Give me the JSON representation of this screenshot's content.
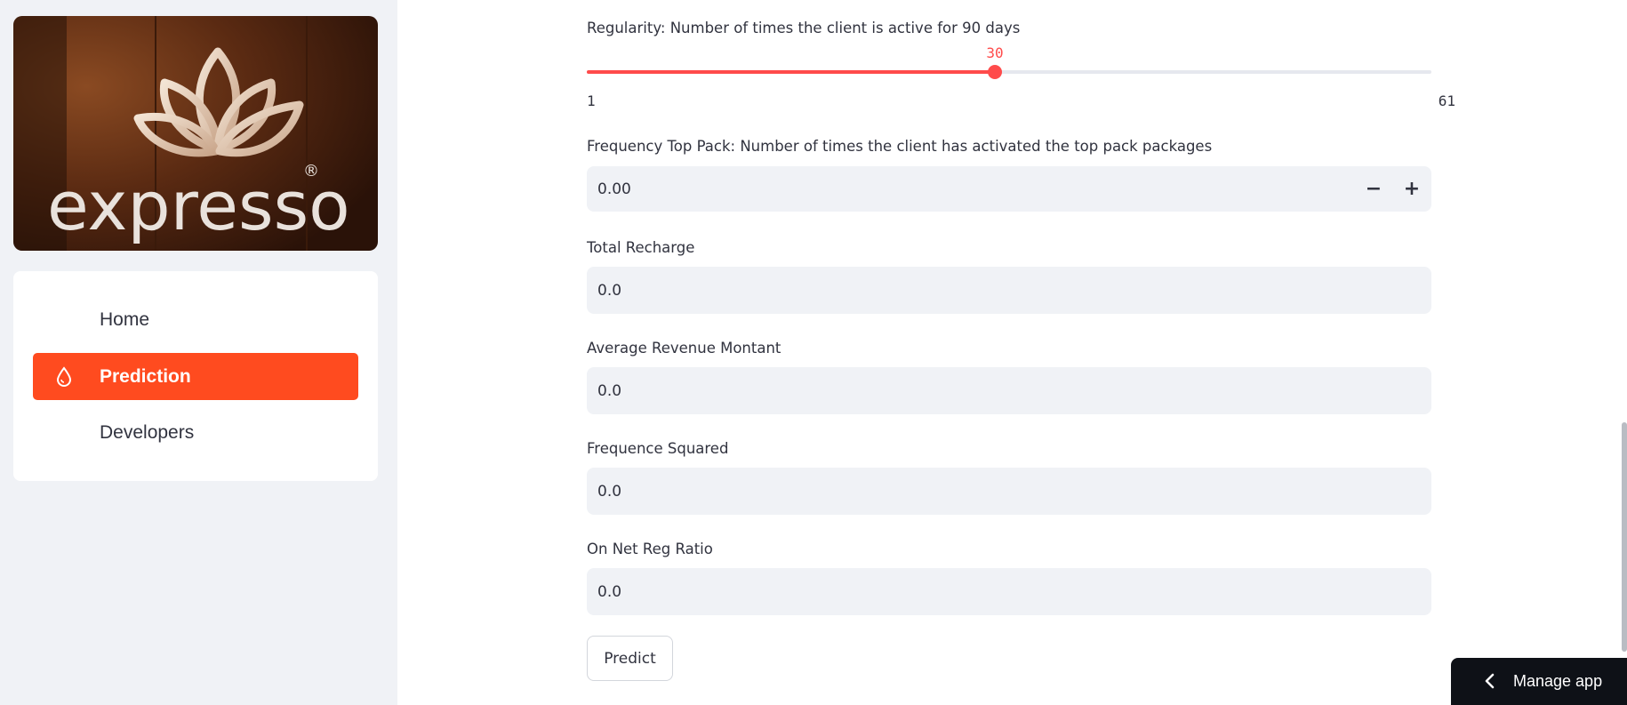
{
  "sidebar": {
    "logo_text": "expresso",
    "menu": [
      {
        "label": "Home",
        "active": false
      },
      {
        "label": "Prediction",
        "active": true,
        "icon": "droplet-icon"
      },
      {
        "label": "Developers",
        "active": false
      }
    ]
  },
  "form": {
    "regularity": {
      "label": "Regularity: Number of times the client is active for 90 days",
      "value": "30",
      "min": "1",
      "max": "61",
      "fraction": 0.4833
    },
    "freq_top_pack": {
      "label": "Frequency Top Pack: Number of times the client has activated the top pack packages",
      "value": "0.00",
      "minus": "−",
      "plus": "+"
    },
    "total_recharge": {
      "label": "Total Recharge",
      "value": "0.0"
    },
    "avg_revenue": {
      "label": "Average Revenue Montant",
      "value": "0.0"
    },
    "freq_squared": {
      "label": "Frequence Squared",
      "value": "0.0"
    },
    "on_net_reg_ratio": {
      "label": "On Net Reg Ratio",
      "value": "0.0"
    },
    "predict_label": "Predict"
  },
  "manage_app": {
    "label": "Manage app"
  },
  "colors": {
    "accent": "#ff4b1f",
    "slider": "#ff4b4b",
    "input_bg": "#f0f2f6"
  }
}
